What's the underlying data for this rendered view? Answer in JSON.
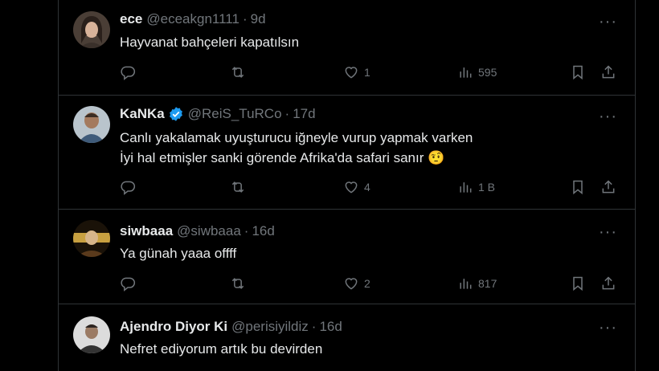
{
  "tweets": [
    {
      "name": "ece",
      "handle": "@eceakgn1111",
      "time": "9d",
      "text_lines": [
        "Hayvanat bahçeleri kapatılsın"
      ],
      "likes": "1",
      "views": "595",
      "verified": false,
      "avatar_color": "#6b5a4e"
    },
    {
      "name": "KaNKa",
      "handle": "@ReiS_TuRCo",
      "time": "17d",
      "text_lines": [
        "Canlı yakalamak uyuşturucu iğneyle vurup yapmak varken",
        "İyi hal etmişler sanki görende Afrika'da safari sanır 🤨"
      ],
      "likes": "4",
      "views": "1 B",
      "verified": true,
      "avatar_color": "#8a8f96"
    },
    {
      "name": "siwbaaa",
      "handle": "@siwbaaa",
      "time": "16d",
      "text_lines": [
        "Ya günah yaaa offff"
      ],
      "likes": "2",
      "views": "817",
      "verified": false,
      "avatar_color": "#a07b2e"
    },
    {
      "name": "Ajendro Diyor Ki",
      "handle": "@perisiyildiz",
      "time": "16d",
      "text_lines": [
        "Nefret ediyorum artık bu devirden"
      ],
      "verified": false,
      "avatar_color": "#7d7d7d"
    }
  ],
  "colors": {
    "background": "#000000",
    "primary_text": "#e7e9ea",
    "secondary_text": "#71767b",
    "divider": "#2f3336",
    "verified_badge": "#1d9bf0"
  }
}
